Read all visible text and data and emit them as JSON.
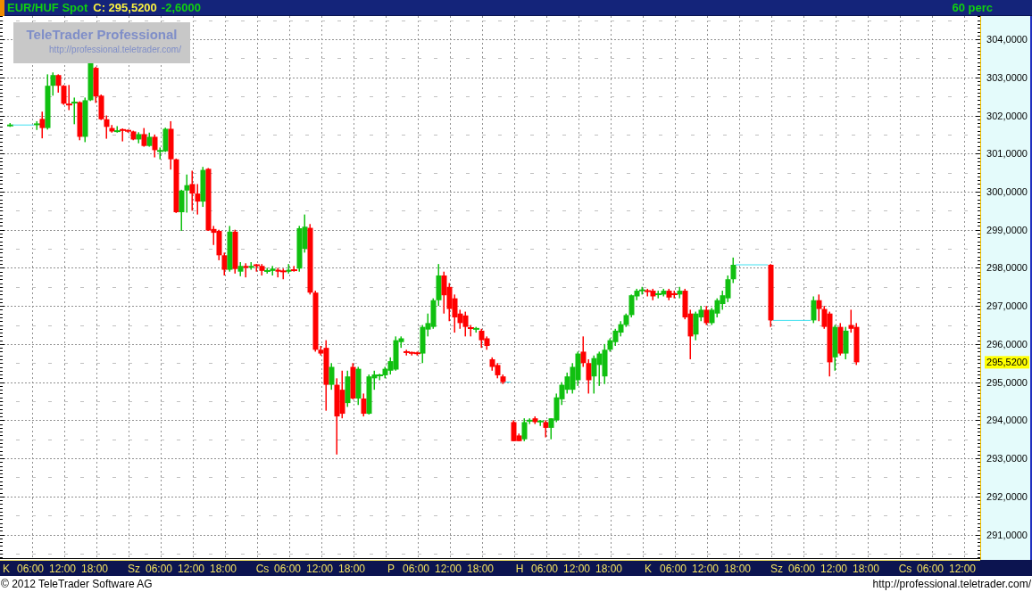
{
  "title_bar": {
    "symbol": "EUR/HUF Spot",
    "close": "C: 295,5200",
    "change": "-2,6000",
    "interval": "60 perc"
  },
  "logo": {
    "name": "TeleTrader Professional",
    "url": "http://professional.teletrader.com/"
  },
  "price_axis": [
    "304,0000",
    "303,0000",
    "302,0000",
    "301,0000",
    "300,0000",
    "299,0000",
    "298,0000",
    "297,0000",
    "296,0000",
    "295,0000",
    "294,0000",
    "293,0000",
    "292,0000",
    "291,0000"
  ],
  "last_price_label": "295,5200",
  "time_axis": [
    {
      "label": "K",
      "kind": "day"
    },
    {
      "label": "06:00",
      "kind": "time"
    },
    {
      "label": "12:00",
      "kind": "time"
    },
    {
      "label": "18:00",
      "kind": "time"
    },
    {
      "label": "Sz",
      "kind": "day"
    },
    {
      "label": "06:00",
      "kind": "time"
    },
    {
      "label": "12:00",
      "kind": "time"
    },
    {
      "label": "18:00",
      "kind": "time"
    },
    {
      "label": "Cs",
      "kind": "day"
    },
    {
      "label": "06:00",
      "kind": "time"
    },
    {
      "label": "12:00",
      "kind": "time"
    },
    {
      "label": "18:00",
      "kind": "time"
    },
    {
      "label": "P",
      "kind": "day"
    },
    {
      "label": "06:00",
      "kind": "time"
    },
    {
      "label": "12:00",
      "kind": "time"
    },
    {
      "label": "18:00",
      "kind": "time"
    },
    {
      "label": "H",
      "kind": "day"
    },
    {
      "label": "06:00",
      "kind": "time"
    },
    {
      "label": "12:00",
      "kind": "time"
    },
    {
      "label": "18:00",
      "kind": "time"
    },
    {
      "label": "K",
      "kind": "day"
    },
    {
      "label": "06:00",
      "kind": "time"
    },
    {
      "label": "12:00",
      "kind": "time"
    },
    {
      "label": "18:00",
      "kind": "time"
    },
    {
      "label": "Sz",
      "kind": "day"
    },
    {
      "label": "06:00",
      "kind": "time"
    },
    {
      "label": "12:00",
      "kind": "time"
    },
    {
      "label": "18:00",
      "kind": "time"
    },
    {
      "label": "Cs",
      "kind": "day"
    },
    {
      "label": "06:00",
      "kind": "time"
    },
    {
      "label": "12:00",
      "kind": "time"
    }
  ],
  "footer": {
    "copyright": "© 2012 TeleTrader Software AG",
    "url": "http://professional.teletrader.com/"
  }
}
